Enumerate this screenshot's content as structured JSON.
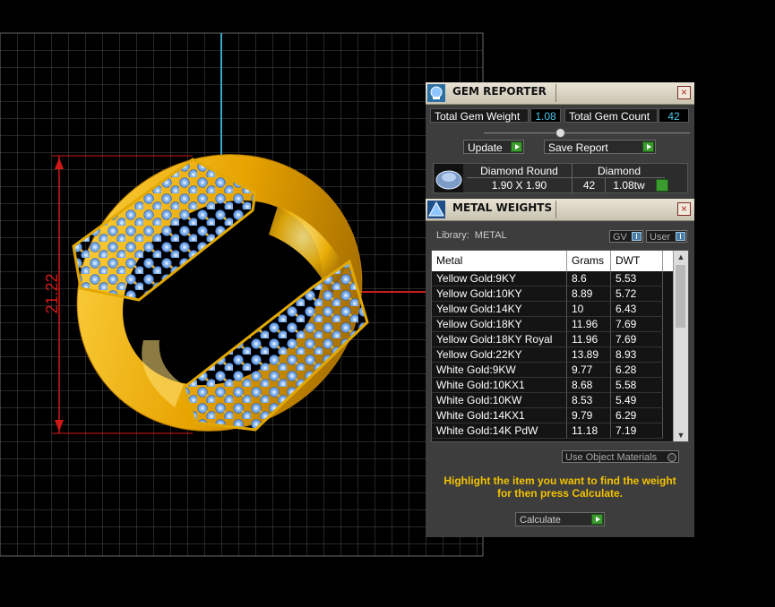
{
  "viewport": {
    "dimension_label": "21.22"
  },
  "gem_reporter": {
    "title": "GEM REPORTER",
    "close_glyph": "×",
    "total_gem_weight_label": "Total Gem Weight",
    "total_gem_weight_value": "1.08",
    "total_gem_count_label": "Total Gem Count",
    "total_gem_count_value": "42",
    "update_label": "Update",
    "save_report_label": "Save Report",
    "gem": {
      "shape": "Diamond Round",
      "size": "1.90 X 1.90",
      "type": "Diamond",
      "count": "42",
      "weight": "1.08tw"
    }
  },
  "metal_weights": {
    "title": "METAL WEIGHTS",
    "close_glyph": "×",
    "library_label": "Library:  METAL",
    "gv_label": "GV",
    "user_label": "User",
    "columns": [
      "Metal",
      "Grams",
      "DWT"
    ],
    "rows": [
      {
        "metal": "Yellow Gold:9KY",
        "grams": "8.6",
        "dwt": "5.53"
      },
      {
        "metal": "Yellow Gold:10KY",
        "grams": "8.89",
        "dwt": "5.72"
      },
      {
        "metal": "Yellow Gold:14KY",
        "grams": "10",
        "dwt": "6.43"
      },
      {
        "metal": "Yellow Gold:18KY",
        "grams": "11.96",
        "dwt": "7.69"
      },
      {
        "metal": "Yellow Gold:18KY Royal",
        "grams": "11.96",
        "dwt": "7.69"
      },
      {
        "metal": "Yellow Gold:22KY",
        "grams": "13.89",
        "dwt": "8.93"
      },
      {
        "metal": "White Gold:9KW",
        "grams": "9.77",
        "dwt": "6.28"
      },
      {
        "metal": "White Gold:10KX1",
        "grams": "8.68",
        "dwt": "5.58"
      },
      {
        "metal": "White Gold:10KW",
        "grams": "8.53",
        "dwt": "5.49"
      },
      {
        "metal": "White Gold:14KX1",
        "grams": "9.79",
        "dwt": "6.29"
      },
      {
        "metal": "White Gold:14K PdW",
        "grams": "11.18",
        "dwt": "7.19"
      }
    ],
    "use_object_materials_label": "Use Object Materials",
    "instruction": "Highlight the item you want to find the weight for then press Calculate.",
    "calculate_label": "Calculate",
    "scroll_up": "▲",
    "scroll_down": "▼"
  },
  "colors": {
    "accent_cyan": "#4cc6ea",
    "instruction_yellow": "#f2c200",
    "dimension_red": "#d01818",
    "gold": "#e8a800",
    "gem_blue": "#8fb8ee"
  }
}
